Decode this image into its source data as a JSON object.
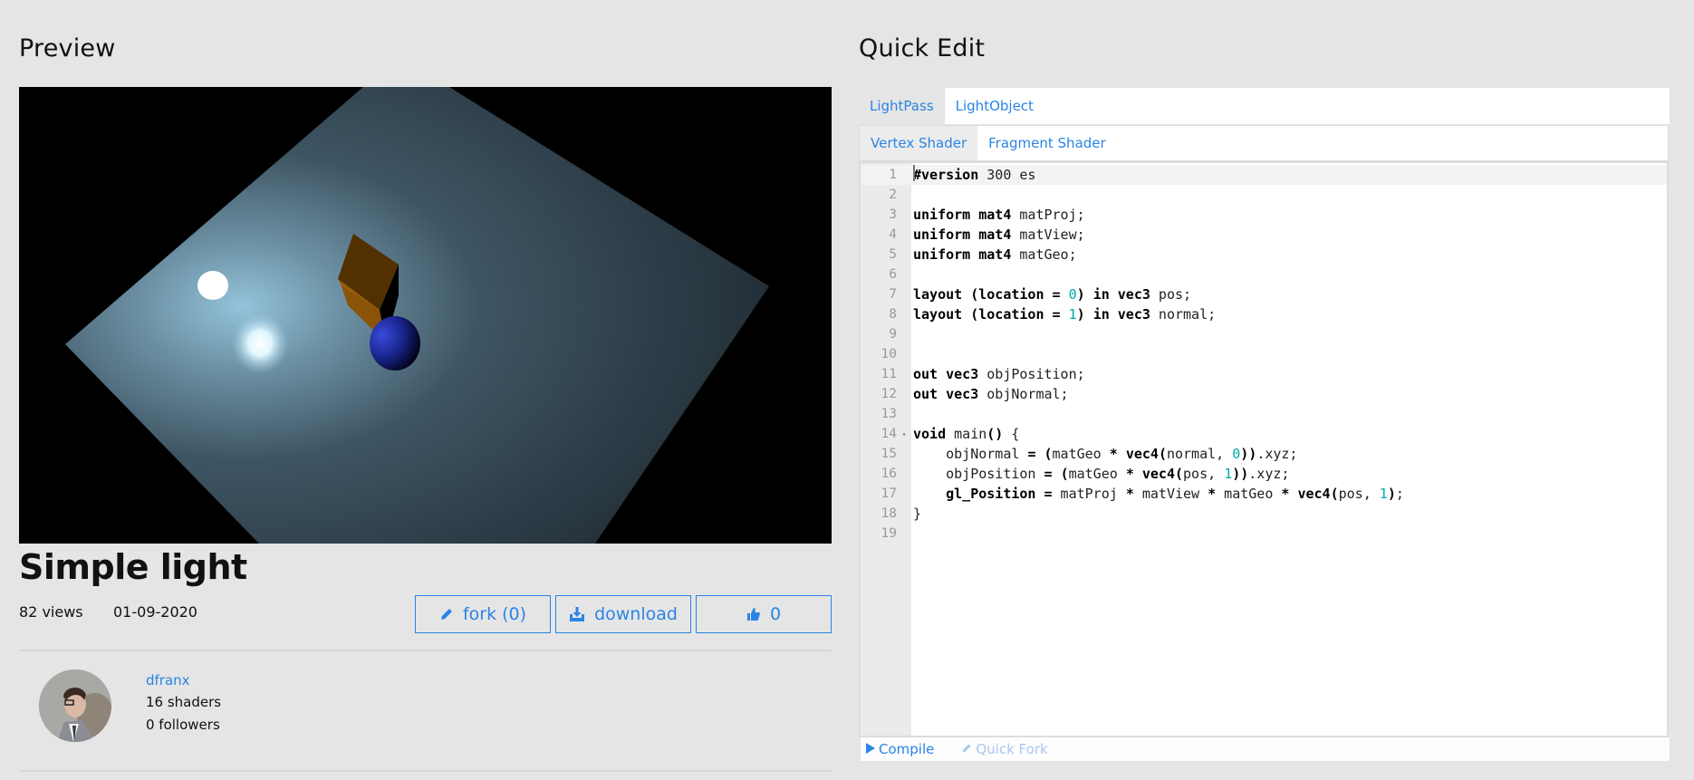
{
  "preview": {
    "heading": "Preview",
    "scene": {
      "background_color": "#000000",
      "plane_color": "#3a4f5c",
      "cube_color": "#8a5307",
      "sphere_color": "#1e2d9a",
      "light_color": "#ffffff"
    }
  },
  "shader": {
    "title": "Simple light",
    "views": "82 views",
    "date": "01-09-2020",
    "actions": {
      "fork": {
        "label": "fork (0)",
        "icon": "pencil-icon"
      },
      "download": {
        "label": "download",
        "icon": "download-icon"
      },
      "like": {
        "label": "0",
        "icon": "thumbs-up-icon"
      }
    }
  },
  "author": {
    "name": "dfranx",
    "shaders": "16 shaders",
    "followers": "0 followers"
  },
  "quick_edit": {
    "heading": "Quick Edit",
    "pass_tabs": [
      {
        "label": "LightPass",
        "active": true
      },
      {
        "label": "LightObject",
        "active": false
      }
    ],
    "shader_tabs": [
      {
        "label": "Vertex Shader",
        "active": true
      },
      {
        "label": "Fragment Shader",
        "active": false
      }
    ],
    "code_lines": [
      "#version 300 es",
      "",
      "uniform mat4 matProj;",
      "uniform mat4 matView;",
      "uniform mat4 matGeo;",
      "",
      "layout (location = 0) in vec3 pos;",
      "layout (location = 1) in vec3 normal;",
      "",
      "",
      "out vec3 objPosition;",
      "out vec3 objNormal;",
      "",
      "void main() {",
      "    objNormal = (matGeo * vec4(normal, 0)).xyz;",
      "    objPosition = (matGeo * vec4(pos, 1)).xyz;",
      "    gl_Position = matProj * matView * matGeo * vec4(pos, 1);",
      "}",
      ""
    ],
    "active_line": 1,
    "fold_line": 14,
    "footer": {
      "compile": "Compile",
      "quick_fork": "Quick Fork"
    }
  },
  "colors": {
    "accent": "#2a84e4",
    "accent_disabled": "#a9c8ef",
    "page_bg": "#e5e5e5",
    "number_literal": "#00aaaa"
  }
}
